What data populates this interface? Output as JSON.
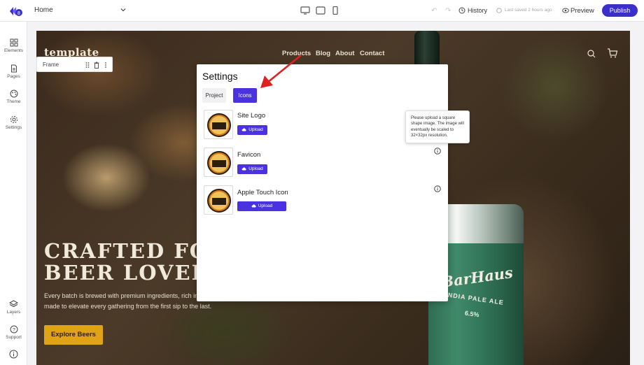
{
  "topbar": {
    "page_name": "Home",
    "history_label": "History",
    "saved_text": "Last saved 2 hours ago",
    "preview_label": "Preview",
    "publish_label": "Publish",
    "brand_color": "#3b2fc9"
  },
  "sidebar": {
    "items": [
      {
        "label": "Elements",
        "icon": "grid-icon"
      },
      {
        "label": "Pages",
        "icon": "document-icon"
      },
      {
        "label": "Theme",
        "icon": "palette-icon"
      },
      {
        "label": "Settings",
        "icon": "gear-icon"
      },
      {
        "label": "Layers",
        "icon": "layers-icon"
      },
      {
        "label": "Support",
        "icon": "help-icon"
      }
    ]
  },
  "frame_toolbar": {
    "label": "Frame"
  },
  "hero": {
    "brand": "template",
    "nav": [
      "Products",
      "Blog",
      "About",
      "Contact"
    ],
    "title_line1": "CRAFTED FOR",
    "title_line2": "BEER LOVERS",
    "description": "Every batch is brewed with premium ingredients, rich in passion. Crisp, refreshing, and made to elevate every gathering from the first sip to the last.",
    "cta": "Explore Beers",
    "can_brand": "BarHaus",
    "can_sub": "INDIA PALE ALE",
    "can_abv": "6.5%",
    "accent_color": "#e0a216"
  },
  "settings_modal": {
    "title": "Settings",
    "tabs": [
      {
        "label": "Project",
        "active": false
      },
      {
        "label": "Icons",
        "active": true
      }
    ],
    "icons": [
      {
        "label": "Site Logo",
        "button": "Upload"
      },
      {
        "label": "Favicon",
        "button": "Upload"
      },
      {
        "label": "Apple Touch Icon",
        "button": "Upload"
      }
    ],
    "tooltip": "Please upload a square shape image. The image will eventually be scaled to 32×32px resolution."
  }
}
